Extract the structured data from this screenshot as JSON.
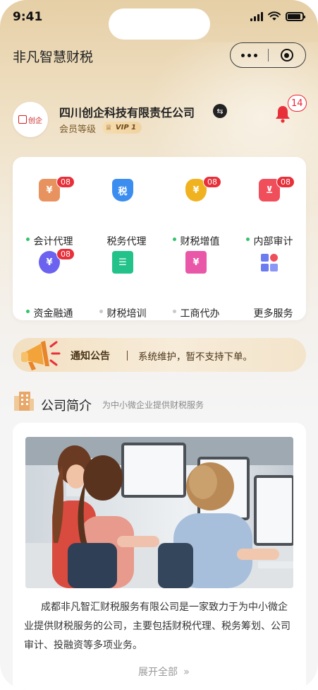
{
  "status": {
    "time": "9:41"
  },
  "header": {
    "title": "非凡智慧财税"
  },
  "company": {
    "logo_text": "创企",
    "name": "四川创企科技有限责任公司",
    "member_label": "会员等级",
    "vip_label": "VIP 1",
    "notification_count": "14"
  },
  "services": [
    {
      "label": "会计代理",
      "badge": "08",
      "icon": "yuan-bag-icon",
      "color": "#e8935f",
      "dot": "#32c36c"
    },
    {
      "label": "税务代理",
      "badge": "",
      "icon": "tax-shield-icon",
      "color": "#3b8ef0",
      "dot": ""
    },
    {
      "label": "财税增值",
      "badge": "08",
      "icon": "money-bag-icon",
      "color": "#f0b21f",
      "dot": "#32c36c"
    },
    {
      "label": "内部审计",
      "badge": "08",
      "icon": "inbox-audit-icon",
      "color": "#f04e5b",
      "dot": "#32c36c"
    },
    {
      "label": "资金融通",
      "badge": "08",
      "icon": "yuan-coin-icon",
      "color": "#6b63f0",
      "dot": "#32c36c"
    },
    {
      "label": "财税培训",
      "badge": "",
      "icon": "training-card-icon",
      "color": "#22c28a",
      "dot": "#c8c8c8"
    },
    {
      "label": "工商代办",
      "badge": "",
      "icon": "business-register-icon",
      "color": "#e957a8",
      "dot": "#c8c8c8"
    },
    {
      "label": "更多服务",
      "badge": "",
      "icon": "more-grid-icon",
      "color": "#6b7bf0",
      "dot": ""
    }
  ],
  "notice": {
    "title": "通知公告",
    "text": "系统维护，暂不支持下单。"
  },
  "intro": {
    "title": "公司简介",
    "subtitle": "为中小微企业提供财税服务",
    "text": "成都非凡智汇财税服务有限公司是一家致力于为中小微企业提供财税服务的公司，主要包括财税代理、税务筹划、公司审计、投融资等多项业务。",
    "expand_label": "展开全部"
  }
}
